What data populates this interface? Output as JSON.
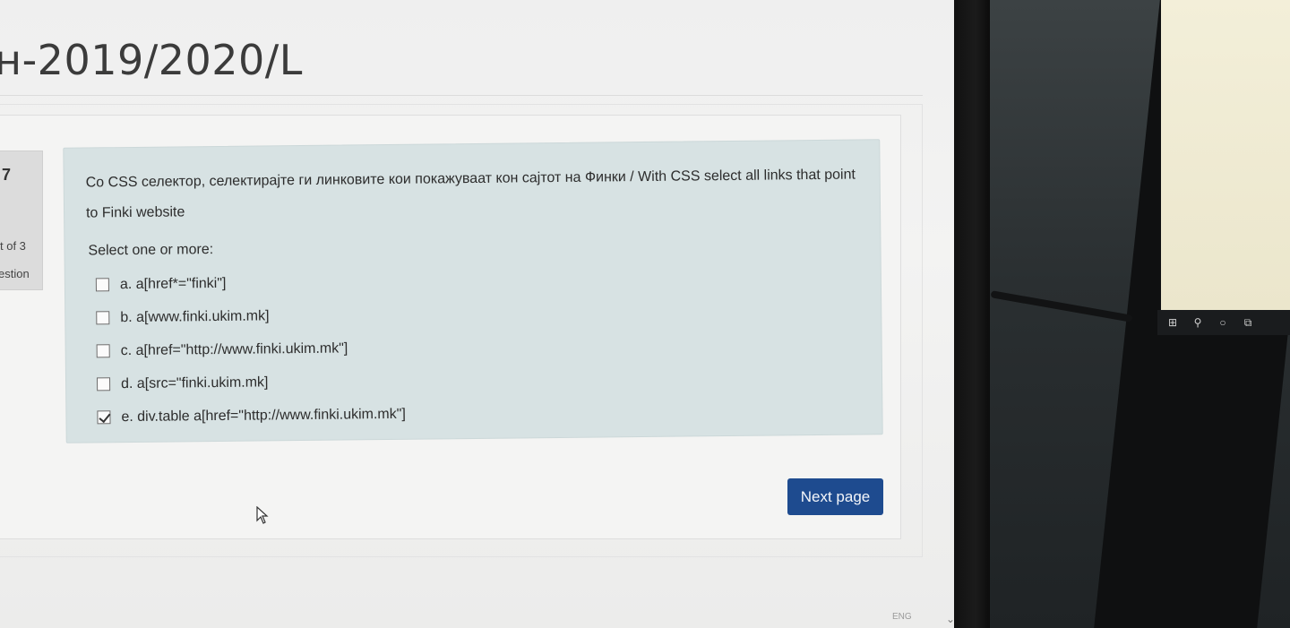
{
  "page": {
    "heading": "н-2019/2020/L"
  },
  "question": {
    "number": "7",
    "state": "t of 3",
    "mark_label": "estion",
    "text": "Со CSS селектор, селектирајте ги линковите кои покажуваат кон сајтот на Финки / With CSS select all links that point to Finki website",
    "prompt": "Select one or more:",
    "answers": [
      {
        "label": "a. a[href*=\"finki\"]",
        "checked": false
      },
      {
        "label": "b. a[www.finki.ukim.mk]",
        "checked": false
      },
      {
        "label": "c. a[href=\"http://www.finki.ukim.mk\"]",
        "checked": false
      },
      {
        "label": "d. a[src=\"finki.ukim.mk]",
        "checked": false
      },
      {
        "label": "e. div.table a[href=\"http://www.finki.ukim.mk\"]",
        "checked": true
      }
    ]
  },
  "navigation": {
    "next_label": "Next page"
  },
  "footer": {
    "lang": "ENG"
  },
  "taskbar": {
    "icons": [
      "windows-icon",
      "search-icon",
      "cortana-icon",
      "task-view-icon"
    ]
  },
  "colors": {
    "button": "#1e4b8f",
    "formulation_bg": "#d7e2e3",
    "info_bg": "#dcdcdc"
  }
}
